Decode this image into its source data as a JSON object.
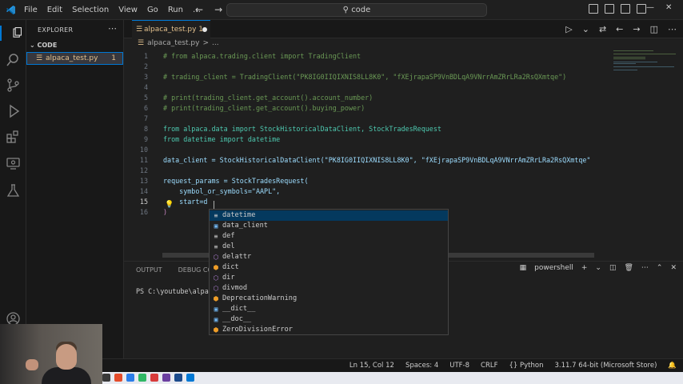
{
  "titlebar": {
    "menu": [
      "File",
      "Edit",
      "Selection",
      "View",
      "Go",
      "Run"
    ],
    "more": "…",
    "search": "code"
  },
  "sidebar": {
    "title": "EXPLORER",
    "section": "CODE",
    "file": {
      "name": "alpaca_test.py",
      "badge": "1"
    }
  },
  "tab": {
    "label": "alpaca_test.py 1"
  },
  "breadcrumb": {
    "file": "alpaca_test.py",
    "sep": ">",
    "rest": "..."
  },
  "editor": {
    "lines": [
      {
        "n": "1",
        "t": "# from alpaca.trading.client import TradingClient"
      },
      {
        "n": "2",
        "t": ""
      },
      {
        "n": "3",
        "t": "# trading_client = TradingClient(\"PK8IG0IIQIXNIS8LL8K0\", \"fXEjrapaSP9VnBDLqA9VNrrAmZRrLRa2RsQXmtqe\")"
      },
      {
        "n": "4",
        "t": ""
      },
      {
        "n": "5",
        "t": "# print(trading_client.get_account().account_number)"
      },
      {
        "n": "6",
        "t": "# print(trading_client.get_account().buying_power)"
      },
      {
        "n": "7",
        "t": ""
      },
      {
        "n": "8",
        "t": "from alpaca.data import StockHistoricalDataClient, StockTradesRequest"
      },
      {
        "n": "9",
        "t": "from datetime import datetime"
      },
      {
        "n": "10",
        "t": ""
      },
      {
        "n": "11",
        "t": "data_client = StockHistoricalDataClient(\"PK8IG0IIQIXNIS8LL8K0\", \"fXEjrapaSP9VnBDLqA9VNrrAmZRrLRa2RsQXmtqe\""
      },
      {
        "n": "12",
        "t": ""
      },
      {
        "n": "13",
        "t": "request_params = StockTradesRequest("
      },
      {
        "n": "14",
        "t": "    symbol_or_symbols=\"AAPL\","
      },
      {
        "n": "15",
        "t": "    start=d"
      },
      {
        "n": "16",
        "t": ")"
      }
    ]
  },
  "suggestions": [
    {
      "icon": "keyword",
      "label": "datetime"
    },
    {
      "icon": "variable",
      "label": "data_client"
    },
    {
      "icon": "keyword",
      "label": "def"
    },
    {
      "icon": "keyword",
      "label": "del"
    },
    {
      "icon": "function",
      "label": "delattr"
    },
    {
      "icon": "class",
      "label": "dict"
    },
    {
      "icon": "function",
      "label": "dir"
    },
    {
      "icon": "function",
      "label": "divmod"
    },
    {
      "icon": "class",
      "label": "DeprecationWarning"
    },
    {
      "icon": "variable",
      "label": "__dict__"
    },
    {
      "icon": "variable",
      "label": "__doc__"
    },
    {
      "icon": "class",
      "label": "ZeroDivisionError"
    }
  ],
  "panel": {
    "tabs": [
      "OUTPUT",
      "DEBUG CONSO"
    ],
    "shell": "powershell",
    "terminal_line": "PS C:\\youtube\\alpac"
  },
  "status": {
    "position": "Ln 15, Col 12",
    "spaces": "Spaces: 4",
    "encoding": "UTF-8",
    "eol": "CRLF",
    "language": "Python",
    "interpreter": "3.11.7 64-bit (Microsoft Store)"
  }
}
